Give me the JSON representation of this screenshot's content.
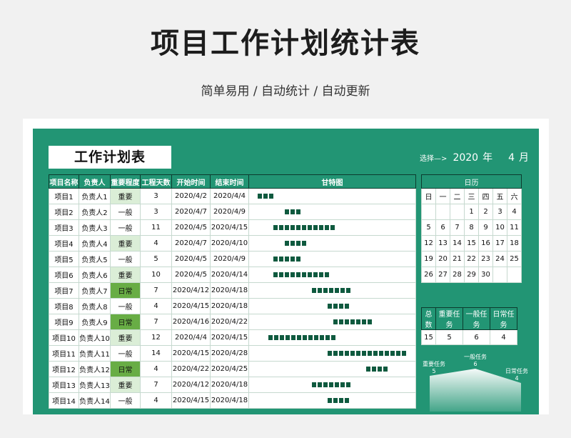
{
  "page": {
    "title": "项目工作计划统计表",
    "subtitle": "简单易用 / 自动统计 / 自动更新"
  },
  "sheet": {
    "title": "工作计划表",
    "selector": {
      "hint": "选择—>",
      "year": "2020",
      "year_unit": "年",
      "month": "4",
      "month_unit": "月"
    }
  },
  "colors": {
    "sheet_bg": "#229574",
    "gantt_block": "#0f5a3f",
    "important": "#dbeed7",
    "daily": "#68ad45"
  },
  "task_table": {
    "headers": [
      "项目名称",
      "负责人",
      "重要程度",
      "工程天数",
      "开始时间",
      "结束时间",
      "甘特图"
    ],
    "rows": [
      {
        "name": "项目1",
        "owner": "负责人1",
        "importance": "重要",
        "days": "3",
        "start": "2020/4/2",
        "end": "2020/4/4"
      },
      {
        "name": "项目2",
        "owner": "负责人2",
        "importance": "一般",
        "days": "3",
        "start": "2020/4/7",
        "end": "2020/4/9"
      },
      {
        "name": "项目3",
        "owner": "负责人3",
        "importance": "一般",
        "days": "11",
        "start": "2020/4/5",
        "end": "2020/4/15"
      },
      {
        "name": "项目4",
        "owner": "负责人4",
        "importance": "重要",
        "days": "4",
        "start": "2020/4/7",
        "end": "2020/4/10"
      },
      {
        "name": "项目5",
        "owner": "负责人5",
        "importance": "一般",
        "days": "5",
        "start": "2020/4/5",
        "end": "2020/4/9"
      },
      {
        "name": "项目6",
        "owner": "负责人6",
        "importance": "重要",
        "days": "10",
        "start": "2020/4/5",
        "end": "2020/4/14"
      },
      {
        "name": "项目7",
        "owner": "负责人7",
        "importance": "日常",
        "days": "7",
        "start": "2020/4/12",
        "end": "2020/4/18"
      },
      {
        "name": "项目8",
        "owner": "负责人8",
        "importance": "一般",
        "days": "4",
        "start": "2020/4/15",
        "end": "2020/4/18"
      },
      {
        "name": "项目9",
        "owner": "负责人9",
        "importance": "日常",
        "days": "7",
        "start": "2020/4/16",
        "end": "2020/4/22"
      },
      {
        "name": "项目10",
        "owner": "负责人10",
        "importance": "重要",
        "days": "12",
        "start": "2020/4/4",
        "end": "2020/4/15"
      },
      {
        "name": "项目11",
        "owner": "负责人11",
        "importance": "一般",
        "days": "14",
        "start": "2020/4/15",
        "end": "2020/4/28"
      },
      {
        "name": "项目12",
        "owner": "负责人12",
        "importance": "日常",
        "days": "4",
        "start": "2020/4/22",
        "end": "2020/4/25"
      },
      {
        "name": "项目13",
        "owner": "负责人13",
        "importance": "重要",
        "days": "7",
        "start": "2020/4/12",
        "end": "2020/4/18"
      },
      {
        "name": "项目14",
        "owner": "负责人14",
        "importance": "一般",
        "days": "4",
        "start": "2020/4/15",
        "end": "2020/4/18"
      }
    ]
  },
  "calendar": {
    "title": "日历",
    "weekdays": [
      "日",
      "一",
      "二",
      "三",
      "四",
      "五",
      "六"
    ],
    "weeks": [
      [
        "",
        "",
        "",
        "1",
        "2",
        "3",
        "4"
      ],
      [
        "5",
        "6",
        "7",
        "8",
        "9",
        "10",
        "11"
      ],
      [
        "12",
        "13",
        "14",
        "15",
        "16",
        "17",
        "18"
      ],
      [
        "19",
        "20",
        "21",
        "22",
        "23",
        "24",
        "25"
      ],
      [
        "26",
        "27",
        "28",
        "29",
        "30",
        "",
        ""
      ]
    ]
  },
  "stats": {
    "labels": [
      "总数",
      "重要任务",
      "一般任务",
      "日常任务"
    ],
    "values": [
      "15",
      "5",
      "6",
      "4"
    ]
  },
  "chart_data": {
    "type": "area",
    "categories": [
      "重要任务",
      "一般任务",
      "日常任务"
    ],
    "values": [
      5,
      6,
      4
    ],
    "title": "",
    "xlabel": "",
    "ylabel": ""
  }
}
